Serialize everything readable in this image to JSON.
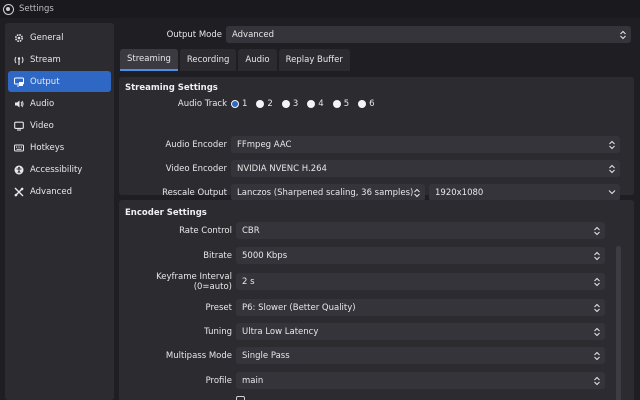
{
  "window": {
    "title": "Settings"
  },
  "sidebar": {
    "items": [
      {
        "label": "General",
        "icon": "gear-icon"
      },
      {
        "label": "Stream",
        "icon": "antenna-icon"
      },
      {
        "label": "Output",
        "icon": "monitor-output-icon",
        "active": true
      },
      {
        "label": "Audio",
        "icon": "speaker-icon"
      },
      {
        "label": "Video",
        "icon": "display-icon"
      },
      {
        "label": "Hotkeys",
        "icon": "keyboard-icon"
      },
      {
        "label": "Accessibility",
        "icon": "accessibility-icon"
      },
      {
        "label": "Advanced",
        "icon": "tools-icon"
      }
    ]
  },
  "output_mode": {
    "label": "Output Mode",
    "value": "Advanced"
  },
  "tabs": [
    {
      "label": "Streaming",
      "active": true
    },
    {
      "label": "Recording"
    },
    {
      "label": "Audio"
    },
    {
      "label": "Replay Buffer"
    }
  ],
  "streaming_settings": {
    "title": "Streaming Settings",
    "audio_track": {
      "label": "Audio Track",
      "options": [
        "1",
        "2",
        "3",
        "4",
        "5",
        "6"
      ],
      "selected": "1"
    },
    "audio_encoder": {
      "label": "Audio Encoder",
      "value": "FFmpeg AAC"
    },
    "video_encoder": {
      "label": "Video Encoder",
      "value": "NVIDIA NVENC H.264"
    },
    "rescale_output": {
      "label": "Rescale Output",
      "value": "Lanczos (Sharpened scaling, 36 samples)",
      "resolution": "1920x1080"
    }
  },
  "encoder_settings": {
    "title": "Encoder Settings",
    "rate_control": {
      "label": "Rate Control",
      "value": "CBR"
    },
    "bitrate": {
      "label": "Bitrate",
      "value": "5000 Kbps"
    },
    "keyframe_interval": {
      "label": "Keyframe Interval (0=auto)",
      "value": "2 s"
    },
    "preset": {
      "label": "Preset",
      "value": "P6: Slower (Better Quality)"
    },
    "tuning": {
      "label": "Tuning",
      "value": "Ultra Low Latency"
    },
    "multipass_mode": {
      "label": "Multipass Mode",
      "value": "Single Pass"
    },
    "profile": {
      "label": "Profile",
      "value": "main"
    }
  },
  "colors": {
    "accent": "#2f68c4",
    "background": "#1f1f23",
    "panel": "#2b2b30",
    "field": "#34343a"
  }
}
